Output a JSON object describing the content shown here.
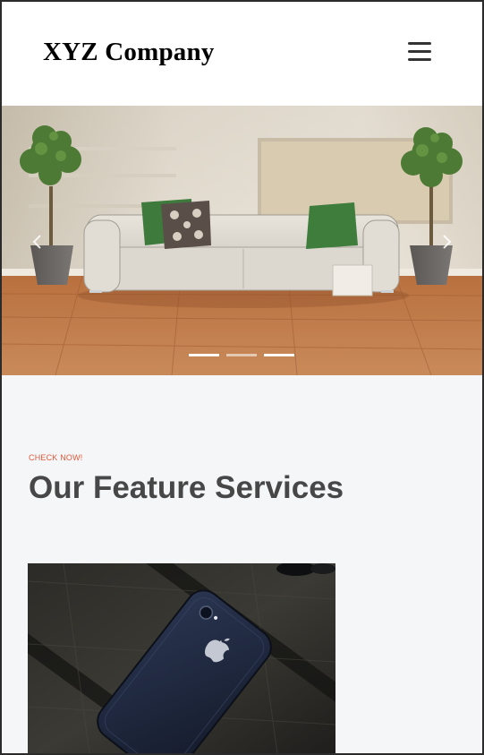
{
  "header": {
    "brand": "XYZ Company",
    "menu_icon": "hamburger-menu-icon"
  },
  "hero": {
    "slide_count": 3,
    "active_slide": 1,
    "prev_icon": "chevron-left-icon",
    "next_icon": "chevron-right-icon"
  },
  "services": {
    "eyebrow": "CHECK NOW!",
    "title": "Our Feature Services"
  },
  "colors": {
    "accent": "#e05a3a",
    "heading": "#474747",
    "section_bg": "#f5f6f8",
    "menu_icon": "#333333"
  }
}
